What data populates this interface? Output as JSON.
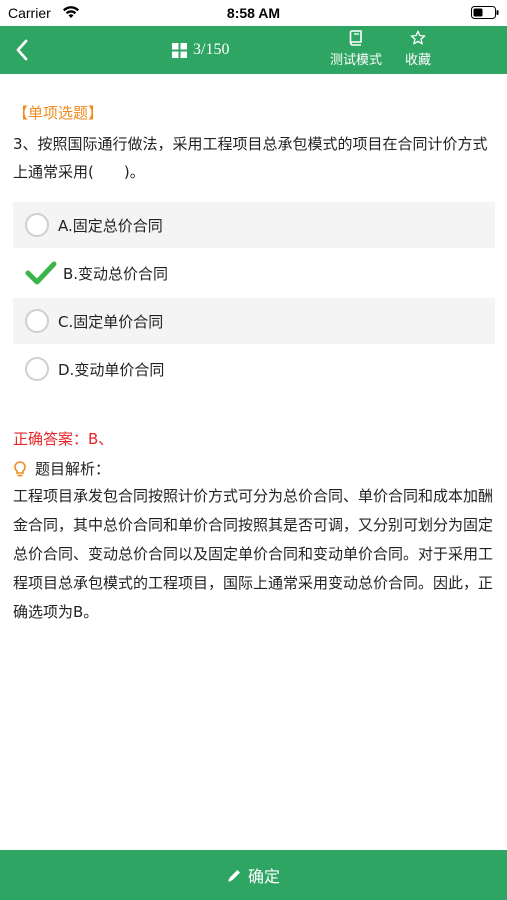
{
  "status_bar": {
    "carrier": "Carrier",
    "time": "8:58 AM"
  },
  "nav": {
    "progress": "3/150",
    "test_mode_label": "测试模式",
    "favorite_label": "收藏",
    "accent_color": "#2ea563"
  },
  "question": {
    "type_label": "【单项选题】",
    "text": "3、按照国际通行做法，采用工程项目总承包模式的项目在合同计价方式上通常采用(　　)。",
    "options": [
      {
        "label": "A.固定总价合同",
        "state": "unselected"
      },
      {
        "label": "B.变动总价合同",
        "state": "correct"
      },
      {
        "label": "C.固定单价合同",
        "state": "unselected"
      },
      {
        "label": "D.变动单价合同",
        "state": "unselected"
      }
    ]
  },
  "answer": {
    "text": "正确答案：B、",
    "color": "#e8262a"
  },
  "analysis": {
    "heading": "题目解析：",
    "text": "工程项目承发包合同按照计价方式可分为总价合同、单价合同和成本加酬金合同，其中总价合同和单价合同按照其是否可调，又分别可划分为固定总价合同、变动总价合同以及固定单价合同和变动单价合同。对于采用工程项目总承包模式的工程项目，国际上通常采用变动总价合同。因此，正确选项为B。"
  },
  "bottom": {
    "confirm_label": "确定"
  }
}
